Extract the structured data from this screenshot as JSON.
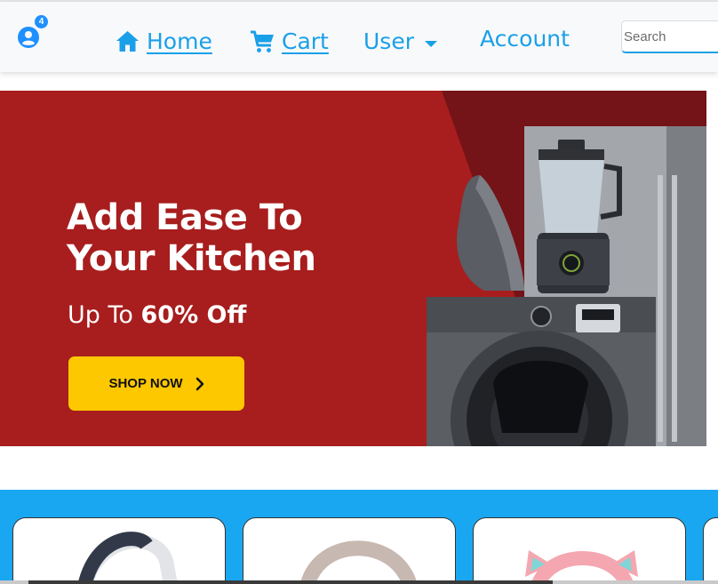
{
  "navbar": {
    "cart_count": "4",
    "links": {
      "home": "Home",
      "cart": "Cart",
      "user": "User",
      "account": "Account"
    },
    "search_placeholder": "Search",
    "icons": [
      "user-circle-icon",
      "home-icon",
      "cart-icon",
      "caret-down-icon"
    ]
  },
  "banner": {
    "headline_line1": "Add Ease To",
    "headline_line2": "Your Kitchen",
    "offer_prefix": "Up To ",
    "offer_value": "60% Off",
    "cta_label": "SHOP NOW",
    "colors": {
      "background": "#a81d1d",
      "cta": "#fdc800"
    }
  },
  "products": {
    "background": "#1aa7f2",
    "cards": [
      {
        "item": "white-headphones"
      },
      {
        "item": "beige-headphones"
      },
      {
        "item": "pink-cat-ear-headphones"
      },
      {
        "item": "partial-card"
      }
    ]
  },
  "colors": {
    "accent": "#1aa0e8"
  }
}
